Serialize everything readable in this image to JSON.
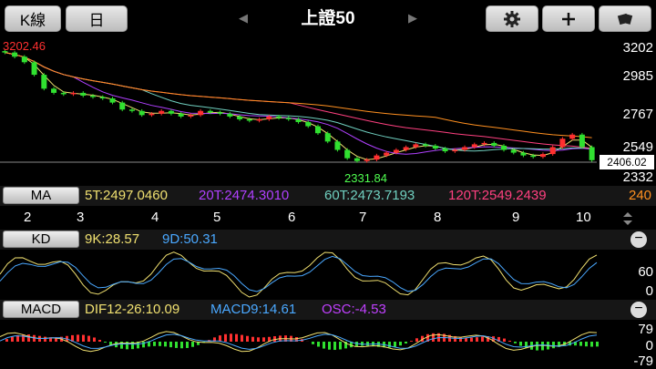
{
  "toolbar": {
    "kline_label": "K線",
    "period_label": "日",
    "title": "上證50",
    "prev_arrow": "◀",
    "next_arrow": "▶",
    "gear_icon": "gear-icon",
    "add_icon": "plus-icon",
    "rotate_icon": "rotate-icon"
  },
  "price_axis": {
    "labels": [
      "3202",
      "2985",
      "2767",
      "2549",
      "2332"
    ],
    "high_label": "3202.46",
    "low_label": "2331.84",
    "last_label": "2406.02"
  },
  "ma_strip": {
    "button": "MA",
    "ma5": "5T:2497.0460",
    "ma20": "20T:2474.3010",
    "ma60": "60T:2473.7193",
    "ma120": "120T:2549.2439",
    "ma240": "240",
    "colors": {
      "ma5": "#f0e070",
      "ma20": "#b040ff",
      "ma60": "#70d0c0",
      "ma120": "#ff4080",
      "ma240": "#ff9020"
    }
  },
  "month_axis": [
    "2",
    "3",
    "4",
    "5",
    "6",
    "7",
    "8",
    "9",
    "10"
  ],
  "kd_strip": {
    "button": "KD",
    "k": "9K:28.57",
    "d": "9D:50.31",
    "axis": [
      "60",
      "0"
    ]
  },
  "macd_strip": {
    "button": "MACD",
    "dif": "DIF12-26:10.09",
    "macd": "MACD9:14.61",
    "osc": "OSC:-4.53",
    "axis": [
      "79",
      "0",
      "-79"
    ]
  },
  "chart_data": {
    "type": "candlestick",
    "title": "上證50",
    "ylim": [
      2300,
      3230
    ],
    "months": [
      "2",
      "3",
      "4",
      "5",
      "6",
      "7",
      "8",
      "9",
      "10"
    ],
    "close": [
      3180,
      3150,
      3110,
      3020,
      2920,
      2890,
      2880,
      2890,
      2870,
      2860,
      2850,
      2820,
      2770,
      2760,
      2730,
      2740,
      2760,
      2740,
      2720,
      2730,
      2760,
      2750,
      2740,
      2720,
      2700,
      2690,
      2700,
      2720,
      2710,
      2700,
      2680,
      2650,
      2600,
      2540,
      2480,
      2420,
      2400,
      2410,
      2440,
      2460,
      2480,
      2500,
      2520,
      2510,
      2490,
      2470,
      2480,
      2500,
      2520,
      2530,
      2510,
      2480,
      2460,
      2440,
      2430,
      2450,
      2500,
      2560,
      2590,
      2500,
      2406
    ]
  }
}
